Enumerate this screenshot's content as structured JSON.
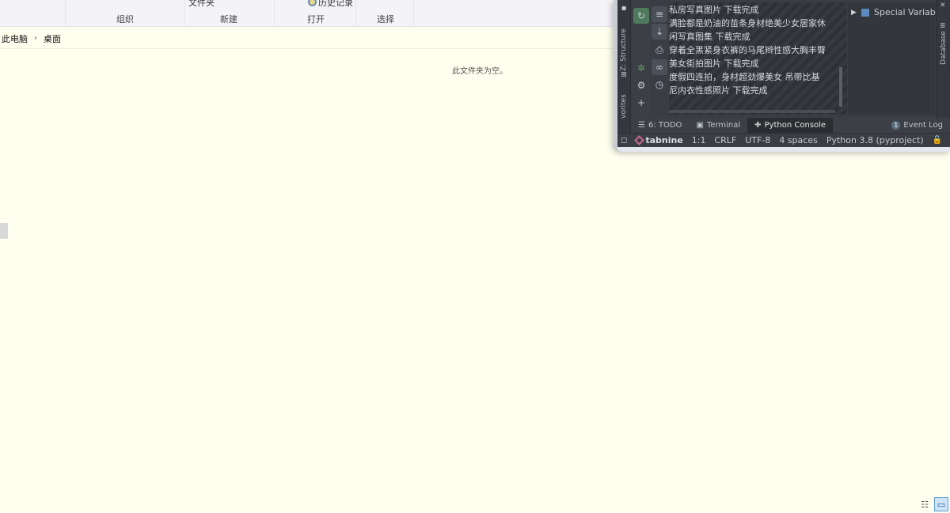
{
  "ribbon": {
    "top_labels": [
      "文件夹",
      "历史记录"
    ],
    "groups": [
      "组织",
      "新建",
      "打开",
      "选择"
    ]
  },
  "address": {
    "crumbs": [
      "此电脑",
      "桌面"
    ]
  },
  "content": {
    "empty_message": "此文件夹为空。"
  },
  "view_toggles": [
    {
      "icon": "details-view-icon",
      "active": false
    },
    {
      "icon": "large-icons-view-icon",
      "active": true
    }
  ],
  "ide": {
    "left_strip_labels": [
      "Z: Structure",
      "vorites"
    ],
    "right_strip_label": "Database",
    "console_lines": [
      "  私房写真图片      下载完成",
      "满脸都是奶油的苗条身材绝美少女居家休",
      "  闲写真图集      下载完成",
      "穿着全黑紧身衣裤的马尾辫性感大胸丰臀",
      "  美女街拍图片      下载完成",
      "度假四连拍，身材超劲爆美女 吊带比基",
      "  尼内衣性感照片      下载完成"
    ],
    "vars_label": "Special Variabl",
    "tabs": [
      {
        "label": "6: TODO",
        "icon": "todo-list-icon",
        "active": false
      },
      {
        "label": "Terminal",
        "icon": "terminal-icon",
        "active": false
      },
      {
        "label": "Python Console",
        "icon": "python-icon",
        "active": true
      }
    ],
    "event_log": {
      "count": "1",
      "label": "Event Log"
    },
    "status": {
      "plugin": "tabnine",
      "position": "1:1",
      "line_sep": "CRLF",
      "encoding": "UTF-8",
      "indent": "4 spaces",
      "interpreter": "Python 3.8 (pyproject)"
    }
  }
}
